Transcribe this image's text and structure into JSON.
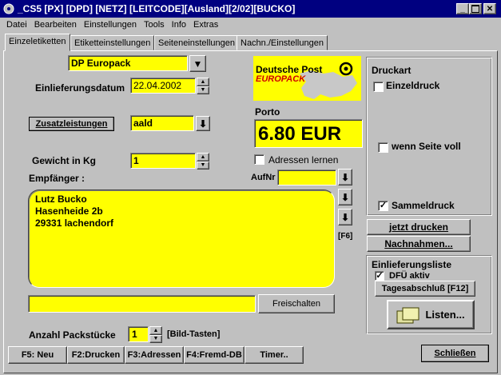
{
  "window": {
    "title": "_CS5 [PX] [DPD] [NETZ] [LEITCODE][Ausland][2/02][BUCKO]"
  },
  "menu": [
    "Datei",
    "Bearbeiten",
    "Einstellungen",
    "Tools",
    "Info",
    "Extras"
  ],
  "tabs": [
    "Einzeletiketten",
    "Etiketteinstellungen",
    "Seiteneinstellungen",
    "Nachn./Einstellungen"
  ],
  "form": {
    "service_value": "DP Europack",
    "einlieferungsdatum_label": "Einlieferungsdatum",
    "einlieferungsdatum_value": "22.04.2002",
    "zusatzleistungen_button": "Zusatzleistungen",
    "zusatzleistungen_value": "aald",
    "gewicht_label": "Gewicht in Kg",
    "gewicht_value": "1",
    "empfaenger_label": "Empfänger :",
    "aufnr_label": "AufNr",
    "aufnr_value": "",
    "address_lines": [
      "Lutz Bucko",
      "Hasenheide 2b",
      "29331 lachendorf"
    ],
    "f6_label": "[F6]",
    "freischalten_value": "",
    "freischalten_button": "Freischalten",
    "anzahl_label": "Anzahl Packstücke",
    "anzahl_value": "1",
    "bild_tasten_label": "[Bild-Tasten]"
  },
  "logo": {
    "line1": "Deutsche Post",
    "line2": "EUROPACK"
  },
  "porto": {
    "label": "Porto",
    "value": "6.80 EUR"
  },
  "adressen_lernen": {
    "label": "Adressen lernen",
    "checked": false
  },
  "druckart": {
    "title": "Druckart",
    "einzeldruck": {
      "label": "Einzeldruck",
      "checked": false
    },
    "wenn_seite_voll": {
      "label": "wenn Seite voll",
      "checked": false
    },
    "sammeldruck": {
      "label": "Sammeldruck",
      "checked": true
    }
  },
  "actions": {
    "jetzt_drucken": "jetzt drucken",
    "nachnahmen": "Nachnahmen..."
  },
  "einlieferungsliste": {
    "title": "Einlieferungsliste",
    "dfue_label": "DFÜ aktiv",
    "dfue_checked": true,
    "tagesabschluss": "Tagesabschluß [F12]",
    "listen": "Listen..."
  },
  "bottom_buttons": [
    "F5: Neu",
    "F2:Drucken",
    "F3:Adressen",
    "F4:Fremd-DB",
    "Timer.."
  ],
  "schliessen": "Schließen",
  "check_mark": "✓",
  "colors": {
    "titlebar": "#000080",
    "field": "#ffff00",
    "face": "#c0c0c0"
  }
}
